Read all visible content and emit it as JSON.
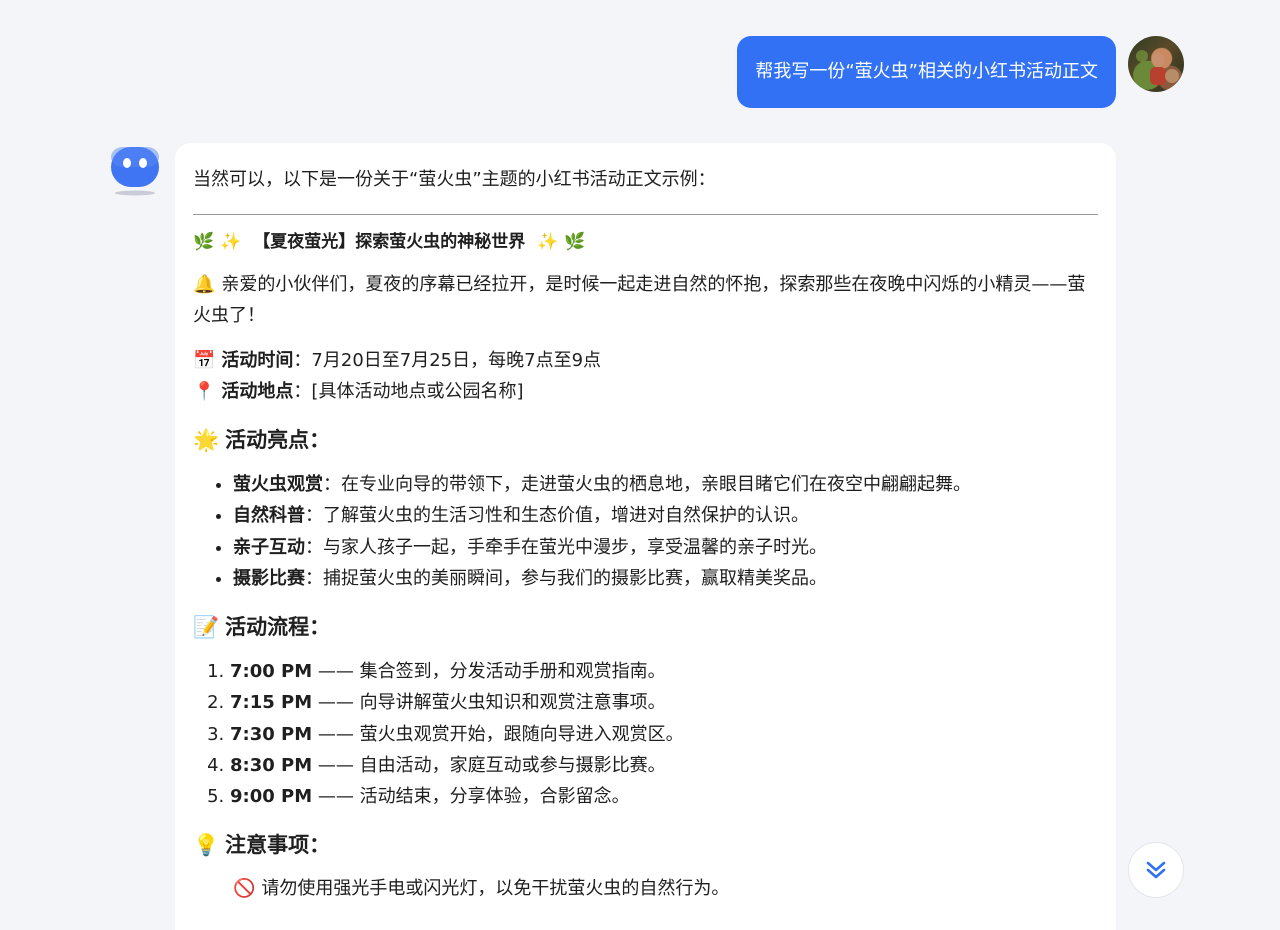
{
  "user_message": {
    "text": "帮我写一份“萤火虫”相关的小红书活动正文"
  },
  "answer": {
    "intro": "当然可以，以下是一份关于“萤火虫”主题的小红书活动正文示例：",
    "title": "【夏夜萤光】探索萤火虫的神秘世界",
    "greeting": "亲爱的小伙伴们，夏夜的序幕已经拉开，是时候一起走进自然的怀抱，探索那些在夜晚中闪烁的小精灵——萤火虫了！",
    "time_label": "活动时间",
    "time_value": "：7月20日至7月25日，每晚7点至9点",
    "place_label": "活动地点",
    "place_value": "：[具体活动地点或公园名称]",
    "highlights_heading": "活动亮点：",
    "highlights": [
      {
        "label": "萤火虫观赏",
        "text": "：在专业向导的带领下，走进萤火虫的栖息地，亲眼目睹它们在夜空中翩翩起舞。"
      },
      {
        "label": "自然科普",
        "text": "：了解萤火虫的生活习性和生态价值，增进对自然保护的认识。"
      },
      {
        "label": "亲子互动",
        "text": "：与家人孩子一起，手牵手在萤光中漫步，享受温馨的亲子时光。"
      },
      {
        "label": "摄影比赛",
        "text": "：捕捉萤火虫的美丽瞬间，参与我们的摄影比赛，赢取精美奖品。"
      }
    ],
    "flow_heading": "活动流程：",
    "flow": [
      {
        "time": "7:00 PM",
        "text": " —— 集合签到，分发活动手册和观赏指南。"
      },
      {
        "time": "7:15 PM",
        "text": " —— 向导讲解萤火虫知识和观赏注意事项。"
      },
      {
        "time": "7:30 PM",
        "text": " —— 萤火虫观赏开始，跟随向导进入观赏区。"
      },
      {
        "time": "8:30 PM",
        "text": " —— 自由活动，家庭互动或参与摄影比赛。"
      },
      {
        "time": "9:00 PM",
        "text": " —— 活动结束，分享体验，合影留念。"
      }
    ],
    "notice_heading": "注意事项：",
    "notice_first": "请勿使用强光手电或闪光灯，以免干扰萤火虫的自然行为。"
  },
  "icons": {
    "herb": "🌿",
    "sparkles": "✨",
    "bell": "🔔",
    "calendar": "📅",
    "pin": "📍",
    "sun": "🌟",
    "memo": "📝",
    "bulb": "💡",
    "no": "🚫"
  },
  "colors": {
    "user_bubble": "#3271f4",
    "bot_avatar": "#3f74f2",
    "background": "#f4f5f9"
  }
}
